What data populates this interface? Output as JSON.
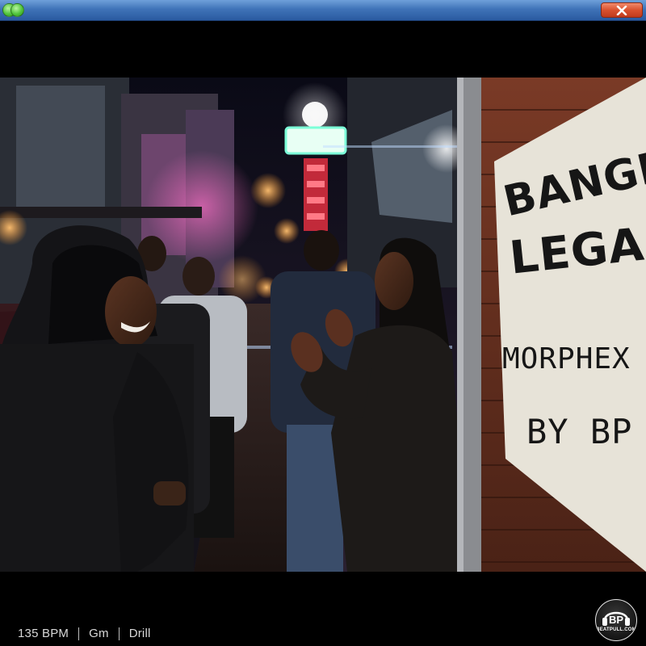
{
  "window": {
    "close_icon": "close-x-icon",
    "maximize_icon": "green-dot-icon",
    "accent": "#3f73b8",
    "close_color": "#d9512e"
  },
  "poster": {
    "line1": "BANGKOK",
    "line2": "LEGACY",
    "line3": "MORPHEX",
    "line4": "BY BP"
  },
  "track": {
    "bpm": "135 BPM",
    "key": "Gm",
    "genre": "Drill"
  },
  "logo": {
    "text": "BEATPULL.COM"
  }
}
